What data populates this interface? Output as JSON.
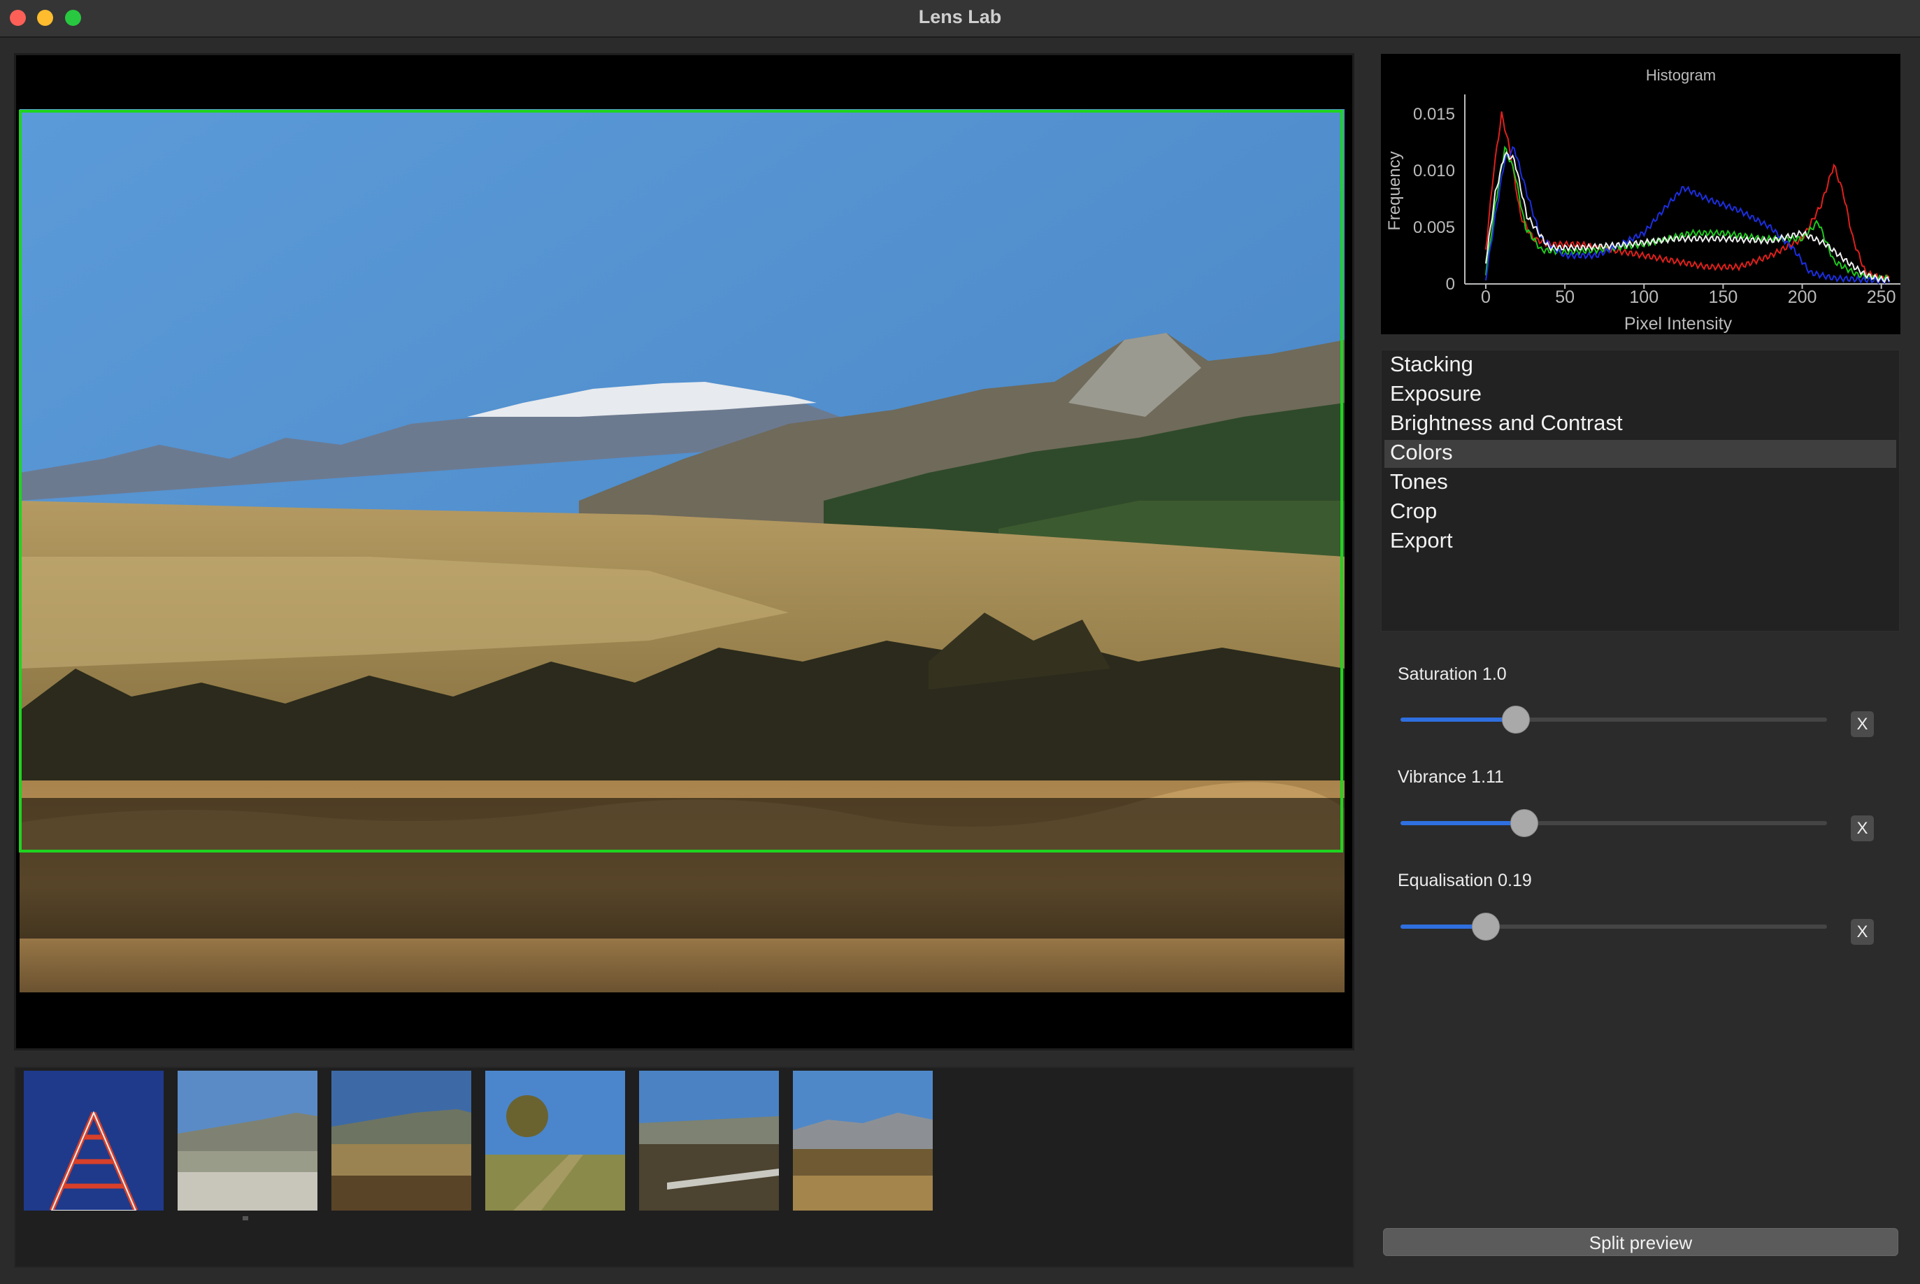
{
  "app": {
    "title": "Lens Lab"
  },
  "histogram": {
    "title": "Histogram",
    "xlabel": "Pixel Intensity",
    "ylabel": "Frequency",
    "x_ticks": [
      "0",
      "50",
      "100",
      "150",
      "200",
      "250"
    ],
    "y_ticks": [
      "0",
      "0.005",
      "0.010",
      "0.015"
    ],
    "xlim": [
      0,
      255
    ],
    "ylim": [
      0,
      0.016
    ],
    "series_colors": {
      "red": "#e0201c",
      "green": "#1ec81e",
      "blue": "#1c2ee0",
      "luma": "#f0f0f0"
    }
  },
  "menu": {
    "items": [
      "Stacking",
      "Exposure",
      "Brightness and Contrast",
      "Colors",
      "Tones",
      "Crop",
      "Export"
    ],
    "selected": "Colors"
  },
  "controls": {
    "saturation": {
      "label": "Saturation 1.0",
      "level": 0.27
    },
    "vibrance": {
      "label": "Vibrance 1.11",
      "level": 0.29
    },
    "equalisation": {
      "label": "Equalisation 0.19",
      "level": 0.2
    },
    "reset_label": "X"
  },
  "footer": {
    "split_preview_label": "Split preview"
  },
  "theme": {
    "crop_color": "#1fd41f",
    "slider_accent": "#2f6fe0"
  }
}
